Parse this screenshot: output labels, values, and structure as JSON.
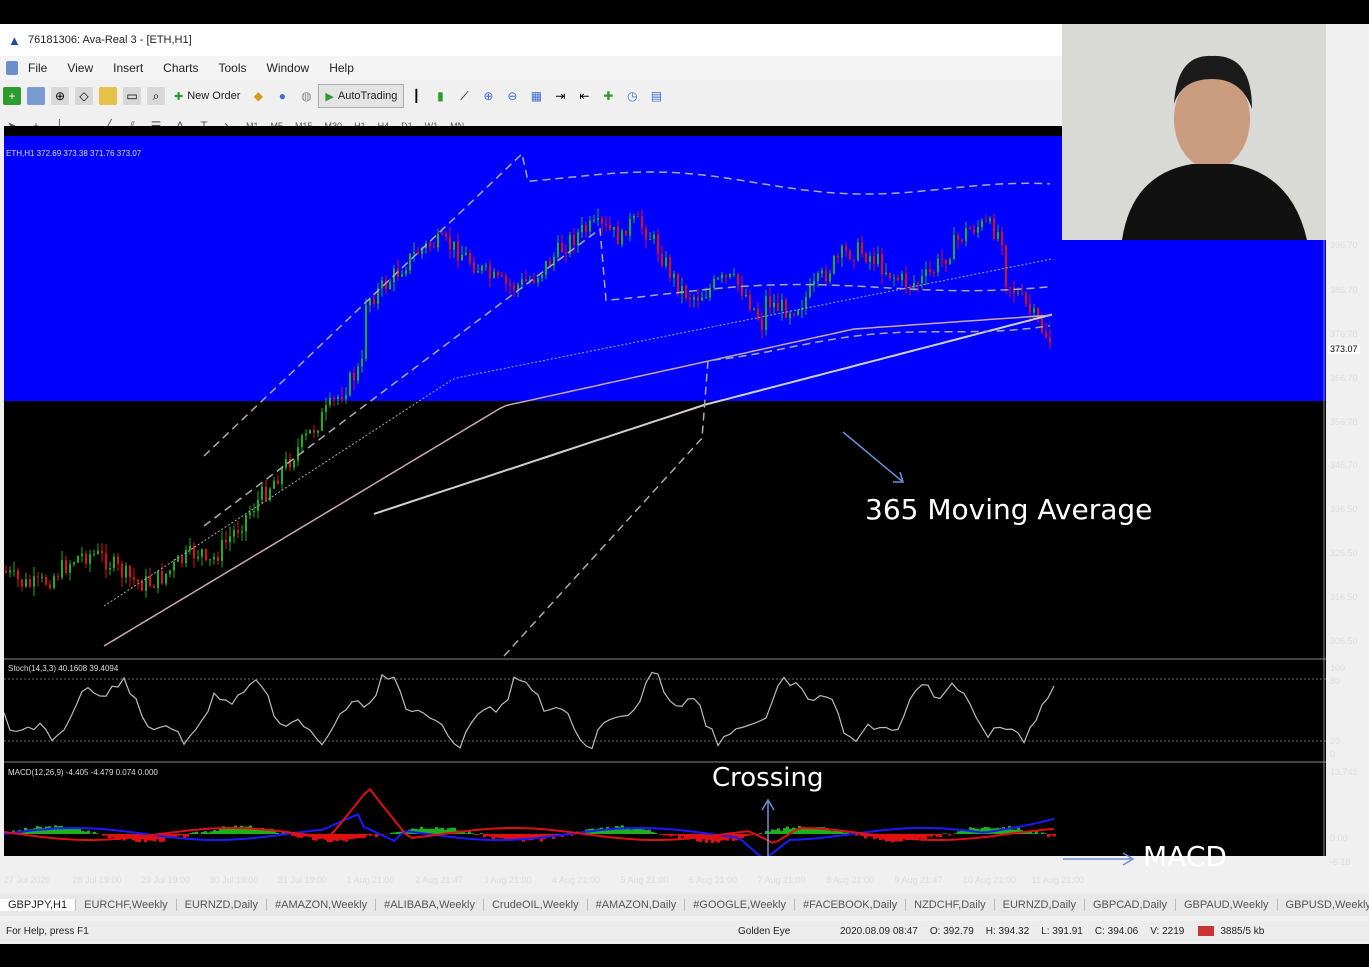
{
  "window": {
    "title": "76181306: Ava-Real 3 - [ETH,H1]"
  },
  "menu": [
    "File",
    "View",
    "Insert",
    "Charts",
    "Tools",
    "Window",
    "Help"
  ],
  "toolbar": {
    "new_order_label": "New Order",
    "autotrading_label": "AutoTrading",
    "timeframes": [
      "M1",
      "M5",
      "M15",
      "M30",
      "H1",
      "H4",
      "D1",
      "W1",
      "MN"
    ]
  },
  "chart": {
    "symbol_info": "ETH,H1  372.69 373.38 371.76 373.07",
    "price_scale": [
      "396.70",
      "386.70",
      "376.70",
      "366.70",
      "356.70",
      "346.70",
      "336.50",
      "326.50",
      "316.50",
      "306.50"
    ],
    "current_price": "373.07",
    "stoch_label": "Stoch(14,3,3) 40.1608 39.4094",
    "stoch_scale": [
      "100",
      "80",
      "20",
      "0"
    ],
    "macd_label": "MACD(12,26,9) -4.405 -4.479 0.074 0.000",
    "macd_scale": [
      "13.741",
      "0.00",
      "-6.18"
    ],
    "time_axis": [
      "27 Jul 2020",
      "28 Jul 19:00",
      "29 Jul 19:00",
      "30 Jul 19:00",
      "31 Jul 19:00",
      "1 Aug 21:00",
      "2 Aug 21:47",
      "3 Aug 21:00",
      "4 Aug 21:00",
      "5 Aug 21:00",
      "6 Aug 21:00",
      "7 Aug 21:00",
      "8 Aug 21:00",
      "9 Aug 21:47",
      "10 Aug 21:00",
      "11 Aug 21:00"
    ]
  },
  "annotations": {
    "ma": "365 Moving Average",
    "crossing": "Crossing",
    "macd": "MACD"
  },
  "tabs": [
    "GBPJPY,H1",
    "EURCHF,Weekly",
    "EURNZD,Daily",
    "#AMAZON,Weekly",
    "#ALIBABA,Weekly",
    "CrudeOIL,Weekly",
    "#AMAZON,Daily",
    "#GOOGLE,Weekly",
    "#FACEBOOK,Daily",
    "NZDCHF,Daily",
    "EURNZD,Daily",
    "GBPCAD,Daily",
    "GBPAUD,Weekly",
    "GBPUSD,Weekly"
  ],
  "status": {
    "help": "For Help, press F1",
    "profile": "Golden Eye",
    "datetime": "2020.08.09 08:47",
    "open": "O: 392.79",
    "high": "H: 394.32",
    "low": "L: 391.91",
    "close": "C: 394.06",
    "volume": "V: 2219",
    "traffic": "3885/5 kb"
  },
  "colors": {
    "highlight": "#0000ff",
    "bull_candle": "#1db01d",
    "bear_candle": "#e01010",
    "macd_line": "#1a1aff",
    "signal_line": "#e01010"
  }
}
